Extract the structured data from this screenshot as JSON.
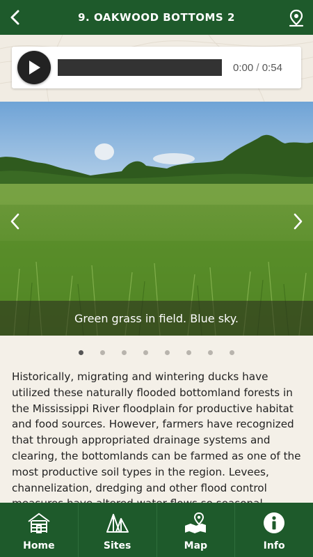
{
  "header": {
    "title": "9. OAKWOOD BOTTOMS 2",
    "back_icon": "chevron-left-icon",
    "location_icon": "map-pin-icon"
  },
  "audio": {
    "current_time": "0:00",
    "separator": "/",
    "duration": "0:54",
    "progress": 0
  },
  "gallery": {
    "caption": "Green grass in field. Blue sky.",
    "total_images": 8,
    "active_index": 0
  },
  "description": "Historically, migrating and wintering ducks have utilized these naturally flooded bottomland forests in the Mississippi River floodplain for productive habitat and food sources. However, farmers have recognized that through appropriated drainage systems and clearing, the bottomlands can be farmed as one of the most productive soil types in the region. Levees, channelization, dredging and other flood control measures have altered water flows so seasonal flooding no longer occurs. Protected areas",
  "tabbar": {
    "items": [
      {
        "label": "Home",
        "icon": "cabin-icon"
      },
      {
        "label": "Sites",
        "icon": "tent-icon"
      },
      {
        "label": "Map",
        "icon": "map-icon"
      },
      {
        "label": "Info",
        "icon": "info-icon"
      }
    ]
  },
  "colors": {
    "brand_green": "#1e5a2b",
    "background": "#f4f0e8"
  }
}
